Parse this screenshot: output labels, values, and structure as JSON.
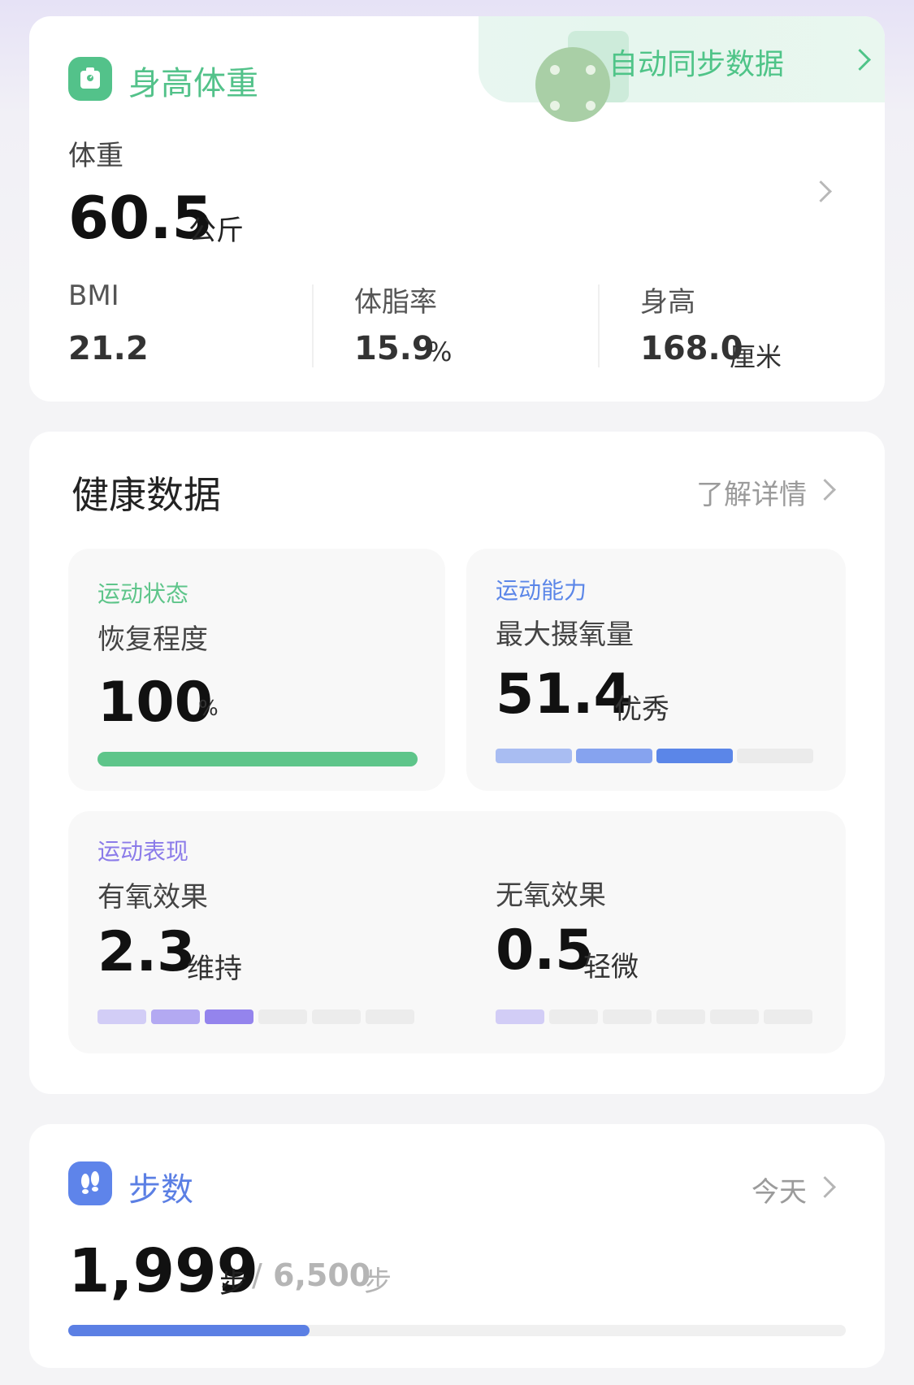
{
  "body_data": {
    "title": "身高体重",
    "sync": {
      "label": "自动同步数据"
    },
    "weight": {
      "label": "体重",
      "value": "60.5",
      "unit": "公斤"
    },
    "metrics": [
      {
        "label": "BMI",
        "value": "21.2",
        "unit": ""
      },
      {
        "label": "体脂率",
        "value": "15.9",
        "unit": "%"
      },
      {
        "label": "身高",
        "value": "168.0",
        "unit": "厘米"
      }
    ],
    "colors": {
      "accent": "#53c28a"
    }
  },
  "health": {
    "title": "健康数据",
    "more_label": "了解详情",
    "tiles": {
      "status": {
        "tag": "运动状态",
        "name": "恢复程度",
        "value": "100",
        "unit": "%",
        "progress": 1.0,
        "color": "#5ec58a"
      },
      "ability": {
        "tag": "运动能力",
        "name": "最大摄氧量",
        "value": "51.4",
        "unit": "优秀",
        "level": 3,
        "levels_total": 4,
        "color": "#5b86e8"
      },
      "performance": {
        "tag": "运动表现",
        "aerobic": {
          "name": "有氧效果",
          "value": "2.3",
          "unit": "维持",
          "level": 3,
          "levels_total": 6
        },
        "anaerobic": {
          "name": "无氧效果",
          "value": "0.5",
          "unit": "轻微",
          "level": 1,
          "levels_total": 6
        },
        "color": "#8b7be9"
      }
    }
  },
  "steps": {
    "title": "步数",
    "period_label": "今天",
    "value": "1,999",
    "unit": "步",
    "separator": "/",
    "goal": "6,500",
    "goal_unit": "步",
    "progress": 0.31,
    "colors": {
      "accent": "#5b7fe4"
    }
  }
}
